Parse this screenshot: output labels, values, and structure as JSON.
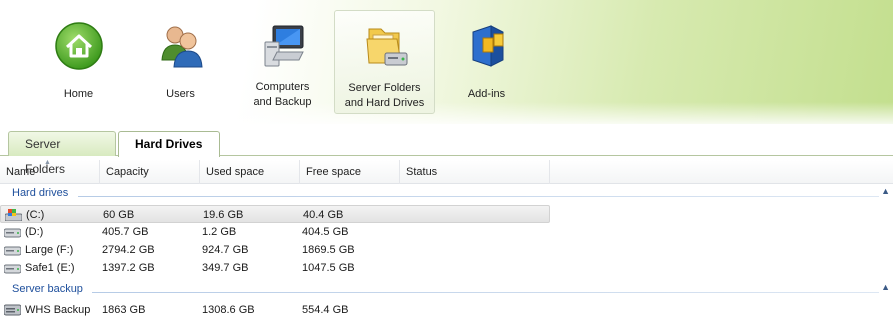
{
  "nav": [
    {
      "id": "home",
      "label": "Home",
      "icon": "home-icon"
    },
    {
      "id": "users",
      "label": "Users",
      "icon": "users-icon"
    },
    {
      "id": "computers",
      "label": "Computers\nand Backup",
      "icon": "computer-icon"
    },
    {
      "id": "server-folders",
      "label": "Server Folders\nand Hard Drives",
      "icon": "folders-drive-icon",
      "selected": true
    },
    {
      "id": "addins",
      "label": "Add-ins",
      "icon": "addins-icon"
    }
  ],
  "tabs": [
    {
      "label": "Server Folders",
      "active": false
    },
    {
      "label": "Hard Drives",
      "active": true
    }
  ],
  "columns": [
    "Name",
    "Capacity",
    "Used space",
    "Free space",
    "Status"
  ],
  "groups": [
    {
      "title": "Hard drives",
      "rows": [
        {
          "name": "(C:)",
          "capacity": "60 GB",
          "used": "19.6 GB",
          "free": "40.4 GB",
          "status": "",
          "icon": "system-drive-icon",
          "selected": true
        },
        {
          "name": "(D:)",
          "capacity": "405.7 GB",
          "used": "1.2 GB",
          "free": "404.5 GB",
          "status": "",
          "icon": "hard-drive-icon"
        },
        {
          "name": "Large (F:)",
          "capacity": "2794.2 GB",
          "used": "924.7 GB",
          "free": "1869.5 GB",
          "status": "",
          "icon": "hard-drive-icon"
        },
        {
          "name": "Safe1 (E:)",
          "capacity": "1397.2 GB",
          "used": "349.7 GB",
          "free": "1047.5 GB",
          "status": "",
          "icon": "hard-drive-icon"
        }
      ]
    },
    {
      "title": "Server backup",
      "rows": [
        {
          "name": "WHS Backup",
          "capacity": "1863 GB",
          "used": "1308.6 GB",
          "free": "554.4 GB",
          "status": "",
          "icon": "backup-drive-icon"
        }
      ]
    }
  ],
  "colors": {
    "accent": "#1e4f9c",
    "tab_border": "#b5c6a0",
    "nav_green": "#c3df8e"
  }
}
